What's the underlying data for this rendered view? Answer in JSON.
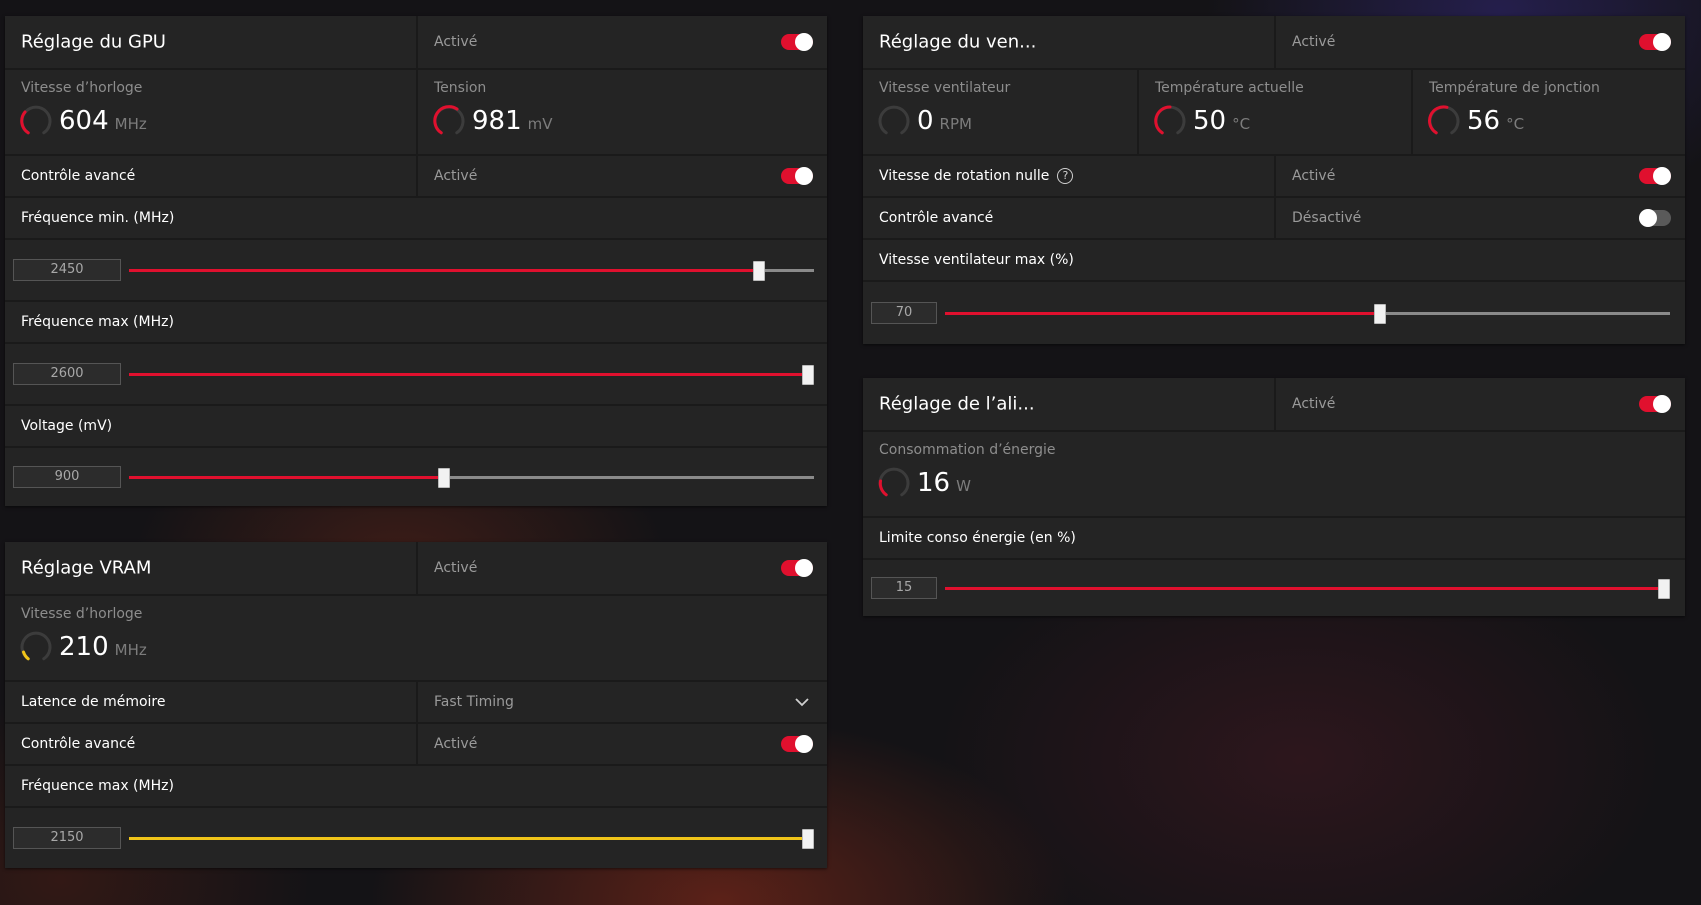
{
  "gpu": {
    "title": "Réglage du GPU",
    "status": "Activé",
    "clock": {
      "label": "Vitesse d’horloge",
      "value": "604",
      "unit": "MHz"
    },
    "voltage": {
      "label": "Tension",
      "value": "981",
      "unit": "mV"
    },
    "advanced": {
      "label": "Contrôle avancé",
      "status": "Activé"
    },
    "freq_min": {
      "label": "Fréquence min. (MHz)",
      "value": "2450",
      "level": 0.92
    },
    "freq_max": {
      "label": "Fréquence max (MHz)",
      "value": "2600",
      "level": 1.0
    },
    "volt_slider": {
      "label": "Voltage (mV)",
      "value": "900",
      "level": 0.46
    }
  },
  "vram": {
    "title": "Réglage VRAM",
    "status": "Activé",
    "clock": {
      "label": "Vitesse d’horloge",
      "value": "210",
      "unit": "MHz"
    },
    "latency": {
      "label": "Latence de mémoire",
      "value": "Fast Timing"
    },
    "advanced": {
      "label": "Contrôle avancé",
      "status": "Activé"
    },
    "freq_max": {
      "label": "Fréquence max (MHz)",
      "value": "2150",
      "level": 1.0
    }
  },
  "fan": {
    "title": "Réglage du ven...",
    "status": "Activé",
    "speed": {
      "label": "Vitesse ventilateur",
      "value": "0",
      "unit": "RPM"
    },
    "temp": {
      "label": "Température actuelle",
      "value": "50",
      "unit": "°C"
    },
    "junction": {
      "label": "Température de jonction",
      "value": "56",
      "unit": "°C"
    },
    "zero_rpm": {
      "label": "Vitesse de rotation nulle",
      "status": "Activé",
      "help": "?"
    },
    "advanced": {
      "label": "Contrôle avancé",
      "status": "Désactivé"
    },
    "max_speed": {
      "label": "Vitesse ventilateur max (%)",
      "value": "70",
      "level": 0.6
    }
  },
  "power": {
    "title": "Réglage de l’ali...",
    "status": "Activé",
    "consumption": {
      "label": "Consommation d’énergie",
      "value": "16",
      "unit": "W"
    },
    "limit": {
      "label": "Limite conso énergie (en %)",
      "value": "15",
      "level": 1.0
    }
  },
  "colors": {
    "accent": "#e0102e",
    "vram_accent": "#f0c419",
    "panel": "#242424",
    "track": "#8a8a8a"
  }
}
